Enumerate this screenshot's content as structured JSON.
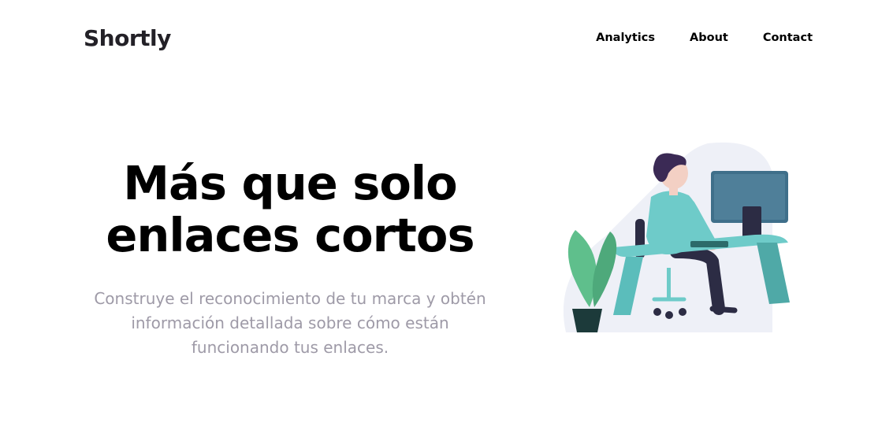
{
  "brand": {
    "name": "Shortly",
    "color": "#232127"
  },
  "nav": {
    "items": [
      {
        "label": "Analytics"
      },
      {
        "label": "About"
      },
      {
        "label": "Contact"
      }
    ]
  },
  "hero": {
    "title": "Más que solo enlaces cortos",
    "subtitle": "Construye el reconocimiento de tu marca y obtén información detallada sobre cómo están funcionando tus enlaces.",
    "illustration": "person-working-at-desk",
    "colors": {
      "title": "#000000",
      "subtitle": "#9e9aa7",
      "accent": "#6ecbc9"
    }
  }
}
